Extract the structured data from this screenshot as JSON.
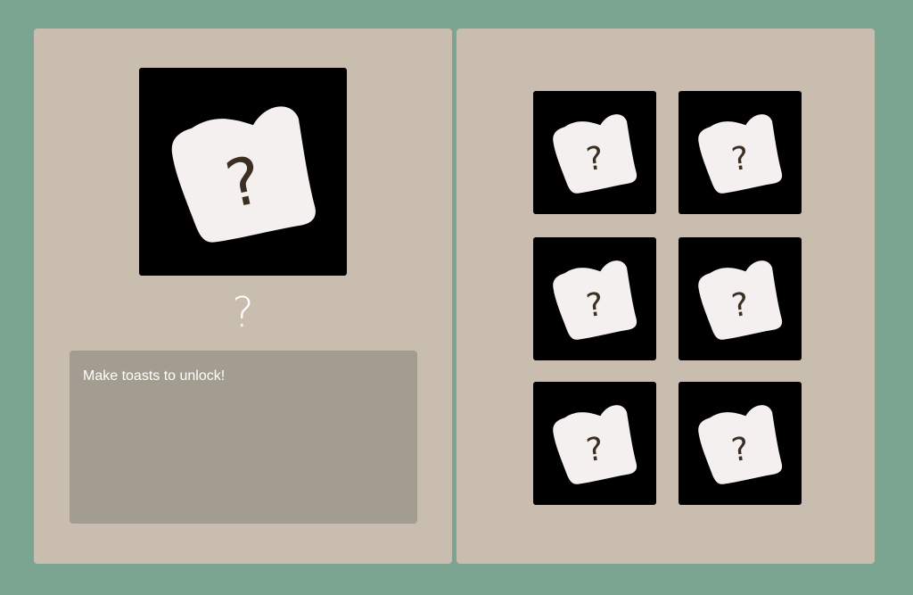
{
  "selected": {
    "name": "?",
    "icon": "locked-toast-icon",
    "description": "Make toasts to unlock!"
  },
  "collection": {
    "items": [
      {
        "icon": "locked-toast-icon",
        "label": "?"
      },
      {
        "icon": "locked-toast-icon",
        "label": "?"
      },
      {
        "icon": "locked-toast-icon",
        "label": "?"
      },
      {
        "icon": "locked-toast-icon",
        "label": "?"
      },
      {
        "icon": "locked-toast-icon",
        "label": "?"
      },
      {
        "icon": "locked-toast-icon",
        "label": "?"
      }
    ]
  },
  "colors": {
    "background": "#7ba491",
    "panel": "#c8bdae",
    "description_box": "#a39c91",
    "card": "#000000",
    "toast": "#f3f0ef",
    "question_mark": "#3b2f22"
  }
}
